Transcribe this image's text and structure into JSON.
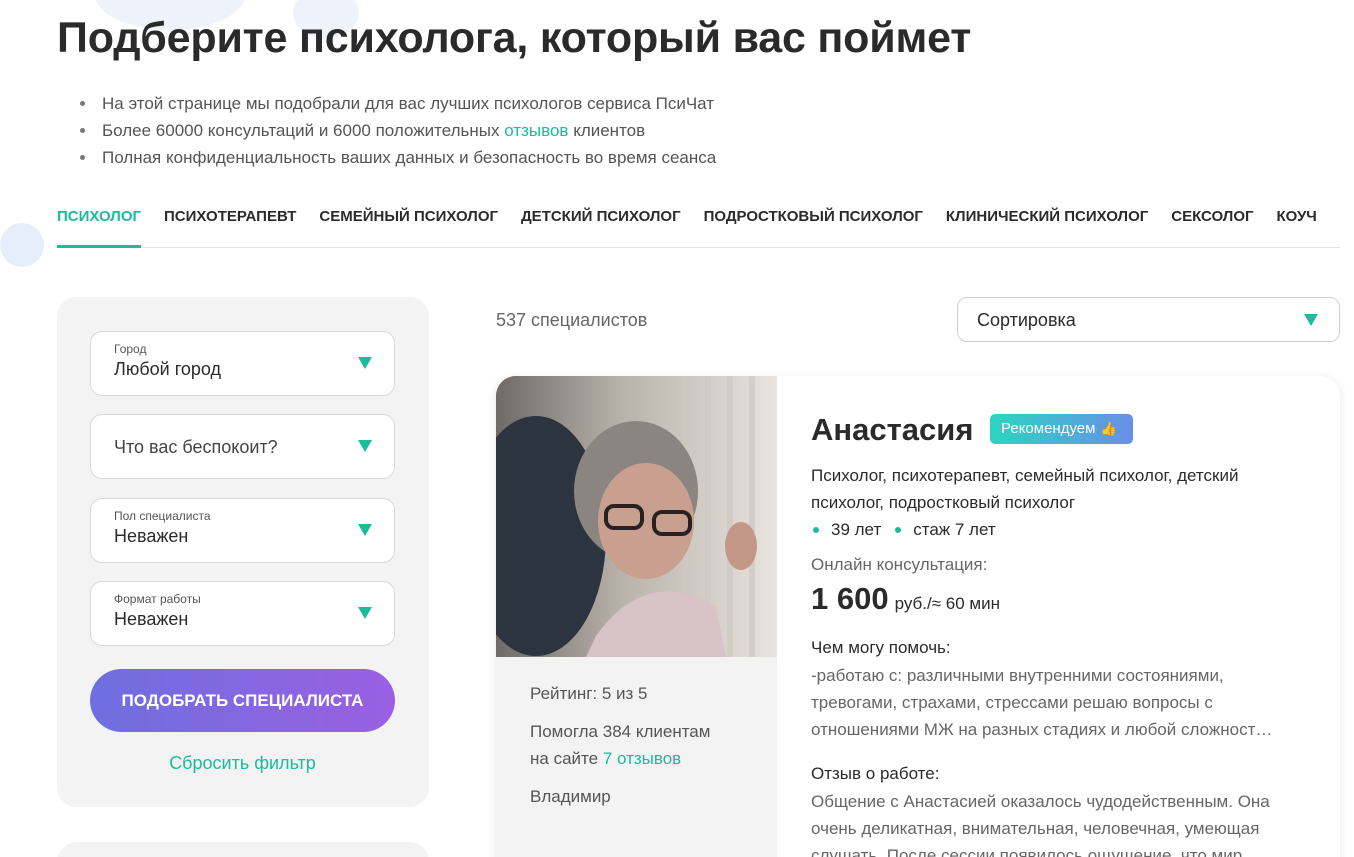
{
  "page": {
    "title": "Подберите психолога, который вас поймет",
    "bullets": {
      "b1": "На этой странице мы подобрали для вас лучших психологов сервиса ПсиЧат",
      "b2_pre": "Более 60000 консультаций и 6000 положительных",
      "b2_link": "отзывов",
      "b2_post": "клиентов",
      "b3": "Полная конфиденциальность ваших данных и безопасность во время сеанса"
    }
  },
  "tabs": [
    {
      "label": "Психолог",
      "active": true
    },
    {
      "label": "Психотерапевт",
      "active": false
    },
    {
      "label": "Семейный психолог",
      "active": false
    },
    {
      "label": "Детский психолог",
      "active": false
    },
    {
      "label": "Подростковый психолог",
      "active": false
    },
    {
      "label": "Клинический психолог",
      "active": false
    },
    {
      "label": "Сексолог",
      "active": false
    },
    {
      "label": "Коуч",
      "active": false
    }
  ],
  "filters": {
    "city": {
      "label": "Город",
      "value": "Любой город"
    },
    "concern": {
      "placeholder": "Что вас беспокоит?"
    },
    "gender": {
      "label": "Пол специалиста",
      "value": "Неважен"
    },
    "format": {
      "label": "Формат работы",
      "value": "Неважен"
    },
    "submit_label": "Подобрать специалиста",
    "reset_label": "Сбросить фильтр"
  },
  "results": {
    "count_text": "537 специалистов",
    "sort_label": "Сортировка"
  },
  "card": {
    "name": "Анастасия",
    "badge": "Рекомендуем",
    "specialization": "Психолог, психотерапевт, семейный психолог, детский психолог, подростковый психолог",
    "age": "39 лет",
    "experience": "стаж 7 лет",
    "online_label": "Онлайн консультация:",
    "price": "1 600",
    "price_unit": "руб./≈ 60 мин",
    "help_title": "Чем могу помочь:",
    "help_text": "-работаю с: различными внутренними состояниями, тревогами, страхами, стрессами решаю вопросы с отношениями МЖ на разных стадиях и любой сложност…",
    "review_title": "Отзыв о работе:",
    "review_text": "Общение с Анастасией оказалось чудодейственным. Она очень деликатная, внимательная, человечная, умеющая слушать. После сессии появилось ощущение, что мир",
    "rating": "Рейтинг: 5 из 5",
    "helped_line1": "Помогла 384 клиентам",
    "helped_line2_pre": "на сайте",
    "reviews_link": "7 отзывов",
    "reviewer": "Владимир"
  },
  "colors": {
    "accent": "#1abc9c",
    "button_gradient_start": "#6e6fe0",
    "button_gradient_end": "#9a5fe3"
  }
}
